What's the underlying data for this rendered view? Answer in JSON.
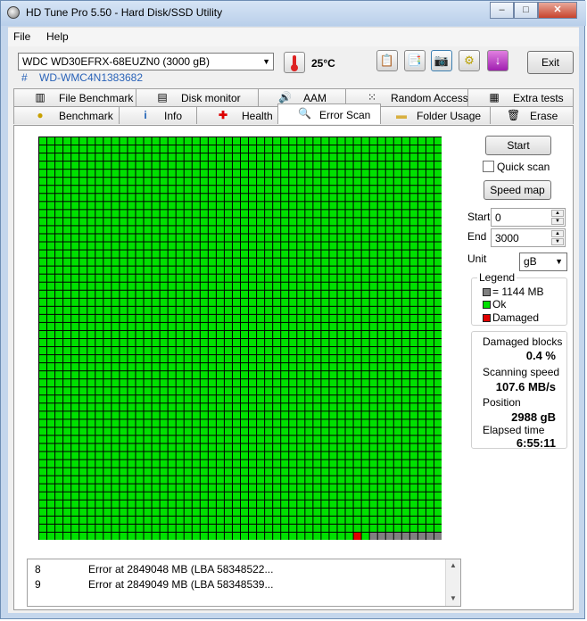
{
  "window": {
    "title": "HD Tune Pro 5.50 - Hard Disk/SSD Utility",
    "controls": {
      "minimize": "–",
      "maximize": "□",
      "close": "✕"
    }
  },
  "menu": {
    "file": "File",
    "help": "Help"
  },
  "toolbar": {
    "drive": "WDC WD30EFRX-68EUZN0 (3000 gB)",
    "serial_hash": "#",
    "serial": "WD-WMC4N1383682",
    "temperature": "25°C",
    "exit_label": "Exit",
    "icons": [
      "copy-text-icon",
      "copy-screen-icon",
      "camera-icon",
      "options-icon",
      "download-icon"
    ]
  },
  "tabs_top": [
    {
      "label": "File Benchmark",
      "icon": "file-benchmark-icon"
    },
    {
      "label": "Disk monitor",
      "icon": "disk-monitor-icon"
    },
    {
      "label": "AAM",
      "icon": "speaker-icon"
    },
    {
      "label": "Random Access",
      "icon": "random-access-icon"
    },
    {
      "label": "Extra tests",
      "icon": "extra-tests-icon"
    }
  ],
  "tabs_bottom": [
    {
      "label": "Benchmark",
      "icon": "benchmark-icon"
    },
    {
      "label": "Info",
      "icon": "info-icon"
    },
    {
      "label": "Health",
      "icon": "health-cross-icon"
    },
    {
      "label": "Error Scan",
      "icon": "magnifier-icon",
      "active": true
    },
    {
      "label": "Folder Usage",
      "icon": "folder-icon"
    },
    {
      "label": "Erase",
      "icon": "trash-icon"
    }
  ],
  "scan": {
    "grid_size": 50,
    "total_blocks": 2500,
    "damaged_block_index": 2489,
    "pending_from_index": 2491,
    "colors": {
      "ok": "#00e000",
      "damaged": "#e00000",
      "pending": "#808080",
      "grid_line": "#000000"
    }
  },
  "controls": {
    "start_label": "Start",
    "quick_scan_label": "Quick scan",
    "quick_scan_checked": false,
    "speed_map_label": "Speed map",
    "start_field_label": "Start",
    "start_value": "0",
    "end_field_label": "End",
    "end_value": "3000",
    "unit_label": "Unit",
    "unit_value": "gB"
  },
  "legend": {
    "title": "Legend",
    "block_size": "= 1144 MB",
    "ok": "Ok",
    "damaged": "Damaged"
  },
  "stats": {
    "damaged_blocks_label": "Damaged blocks",
    "damaged_blocks_value": "0.4 %",
    "scanning_speed_label": "Scanning speed",
    "scanning_speed_value": "107.6 MB/s",
    "position_label": "Position",
    "position_value": "2988 gB",
    "elapsed_label": "Elapsed time",
    "elapsed_value": "6:55:11"
  },
  "log": [
    {
      "index": "8",
      "message": "Error at 2849048 MB (LBA 58348522..."
    },
    {
      "index": "9",
      "message": "Error at 2849049 MB (LBA 58348539..."
    }
  ]
}
